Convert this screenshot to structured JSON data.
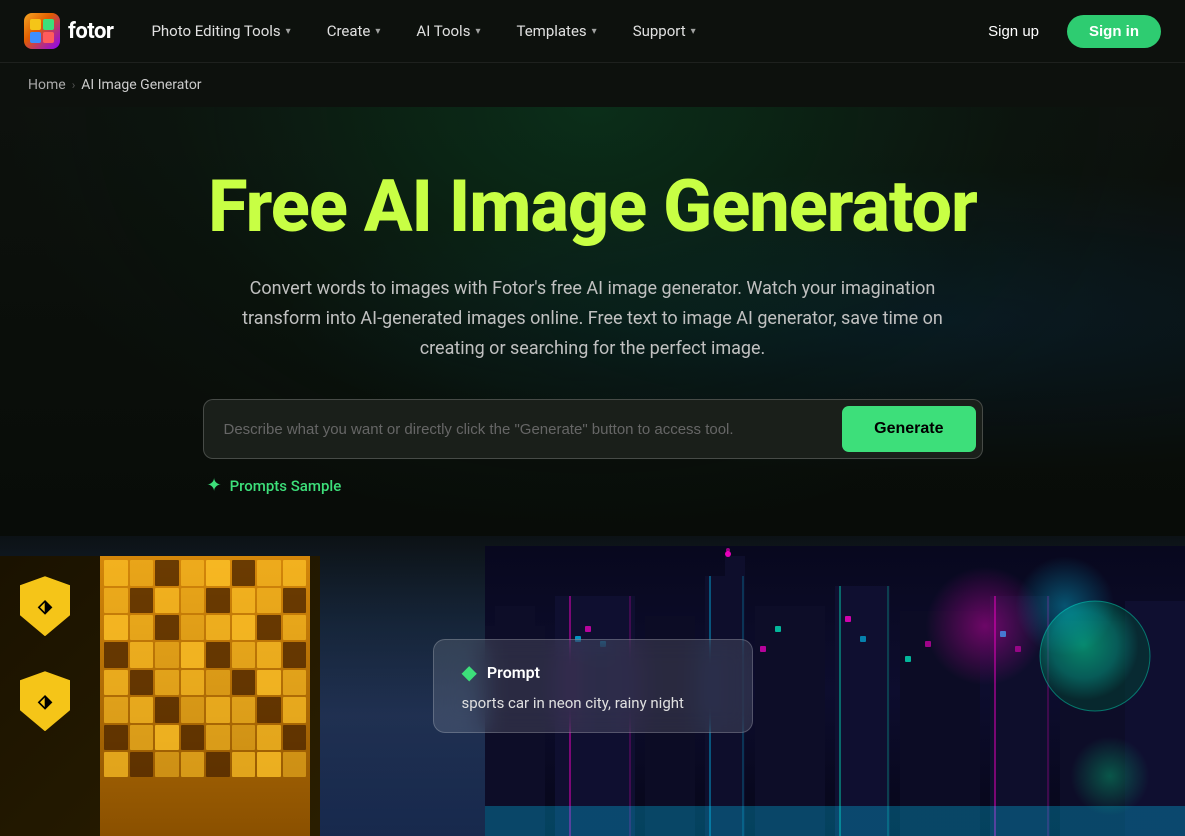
{
  "nav": {
    "logo_text": "fotor",
    "items": [
      {
        "label": "Photo Editing Tools",
        "id": "photo-editing-tools"
      },
      {
        "label": "Create",
        "id": "create"
      },
      {
        "label": "AI Tools",
        "id": "ai-tools"
      },
      {
        "label": "Templates",
        "id": "templates"
      },
      {
        "label": "Support",
        "id": "support"
      }
    ],
    "signup_label": "Sign up",
    "signin_label": "Sign in"
  },
  "breadcrumb": {
    "home_label": "Home",
    "current_label": "AI Image Generator"
  },
  "hero": {
    "title": "Free AI Image Generator",
    "subtitle": "Convert words to images with Fotor's free AI image generator. Watch your imagination transform into AI-generated images online. Free text to image AI generator, save time on creating or searching for the perfect image.",
    "search_placeholder": "Describe what you want or directly click the \"Generate\" button to access tool.",
    "generate_label": "Generate",
    "prompts_sample_label": "Prompts Sample"
  },
  "preview": {
    "prompt_label": "Prompt",
    "prompt_text": "sports car in neon city, rainy night"
  }
}
